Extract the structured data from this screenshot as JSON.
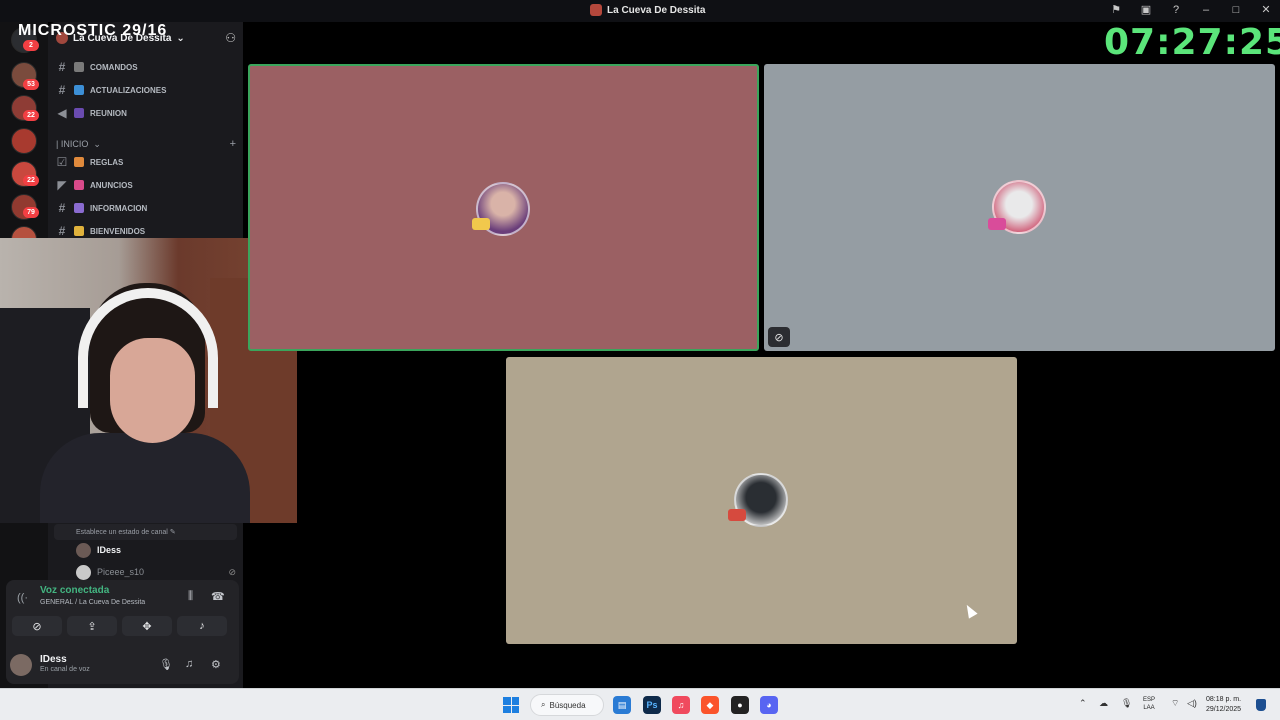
{
  "window": {
    "title": "La Cueva De Dessita",
    "overlay_text": "MICROSTIC 29/16"
  },
  "stream_clock": "07:27:25",
  "server_rail": {
    "badges": [
      "2",
      "53",
      "22",
      "22",
      "79"
    ]
  },
  "sidebar": {
    "server_name": "La Cueva De Dessita",
    "channels_top": [
      {
        "label": "COMANDOS",
        "icon": "hash-icon"
      },
      {
        "label": "ACTUALIZACIONES",
        "icon": "hash-icon"
      },
      {
        "label": "REUNION",
        "icon": "speaker-icon"
      }
    ],
    "category": "| INICIO",
    "channels_inicio": [
      {
        "label": "REGLAS",
        "icon": "rules-icon"
      },
      {
        "label": "ANUNCIOS",
        "icon": "megaphone-icon"
      },
      {
        "label": "INFORMACION",
        "icon": "hash-icon"
      },
      {
        "label": "BIENVENIDOS",
        "icon": "hash-icon"
      }
    ],
    "voice_status_hint": "Establece un estado de canal",
    "voice_members": [
      {
        "name": "IDess",
        "muted": false
      },
      {
        "name": "Piceee_s10",
        "muted": true
      }
    ]
  },
  "voice_panel": {
    "title": "Voz conectada",
    "channel": "GENERAL / La Cueva De Dessita",
    "buttons": [
      "camera-off-icon",
      "screen-share-icon",
      "activities-icon",
      "soundboard-icon"
    ]
  },
  "user_panel": {
    "name": "IDess",
    "status": "En canal de voz"
  },
  "video_tiles": [
    {
      "bg": "#9b6063",
      "speaking": true,
      "muted": false
    },
    {
      "bg": "#959da3",
      "speaking": false,
      "muted": true
    },
    {
      "bg": "#b0a58f",
      "speaking": false,
      "muted": false
    }
  ],
  "taskbar": {
    "search_label": "Búsqueda",
    "lang_top": "ESP",
    "lang_bottom": "LAA",
    "time": "08:18 p. m.",
    "date": "29/12/2025"
  },
  "colors": {
    "speaking_border": "#3ba55c",
    "clock": "#5be57a",
    "connected_green": "#43b581"
  }
}
